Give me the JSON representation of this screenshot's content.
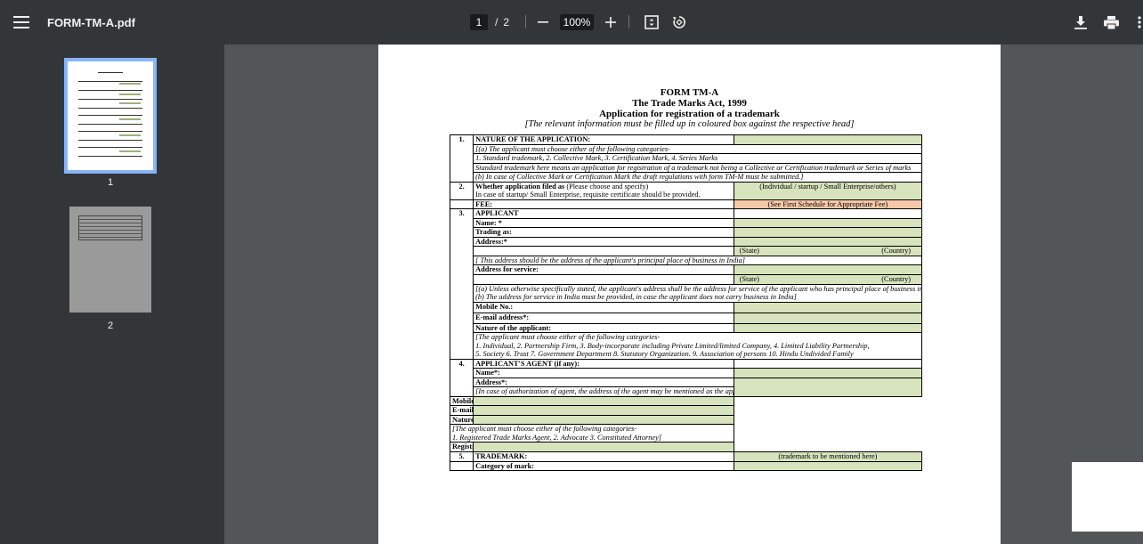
{
  "toolbar": {
    "title": "FORM-TM-A.pdf",
    "page_current": "1",
    "page_separator": "/",
    "page_total": "2",
    "zoom": "100%"
  },
  "sidebar": {
    "thumbnails": [
      {
        "label": "1"
      },
      {
        "label": "2"
      }
    ]
  },
  "document": {
    "header": {
      "line1": "FORM TM-A",
      "line2": "The Trade Marks Act, 1999",
      "line3": "Application for registration of a trademark",
      "line4": "[The relevant information must be filled up in coloured box against the respective head]"
    },
    "rows": {
      "r1_num": "1.",
      "r1_label": "NATURE OF THE APPLICATION:",
      "r1_a": "[(a) The applicant must choose either of the following categories-",
      "r1_b": "1. Standard trademark, 2. Collective Mark, 3. Certification Mark, 4. Series Marks",
      "r1_c": "Standard trademark here means an application for registration of a trademark not being a Collective or Certification trademark or Series of marks",
      "r1_d": "(b) In case of Collective Mark or Certification Mark the draft regulations with form TM-M must be submitted.]",
      "r2_num": "2.",
      "r2_label_bold": "Whether application filed as",
      "r2_label_rest": " (Please choose and specify)",
      "r2_sub": "In case of startup/ Small Enterprise, requisite certificate should be provided.",
      "r2_right": "(Individual / startup / Small Enterprise/others)",
      "fee_label": "FEE:",
      "fee_right": "(See First Schedule for Appropriate Fee)",
      "r3_num": "3.",
      "r3_label": "APPLICANT",
      "name": "Name: *",
      "trading": "Trading as:",
      "address": "Address:*",
      "state": "(State)",
      "country": "(Country)",
      "addr_note": "[ This address should be the address of the applicant's principal place of business in India]",
      "addr_service": "Address for service:",
      "service_note_a": "[(a) Unless otherwise specifically stated, the applicant's address shall be the address for service of the applicant who has principal place of business in India.",
      "service_note_b": "(b) The address for service in India must be provided, in case the applicant does not carry business in India]",
      "mobile": "Mobile No.:",
      "email": "E-mail address*:",
      "nature_applicant": "Nature of the applicant:",
      "nature_note_a": "[The applicant must choose either of the following categories-",
      "nature_note_b": "1. Individual, 2. Partnership Firm, 3. Body-incorporate including Private Limited/limited Company, 4. Limited Liability Partnership,",
      "nature_note_c": "5. Society 6. Trust 7. Government Department 8. Statutory Organization. 9. Association of persons 10. Hindu Undivided Family",
      "r4_num": "4.",
      "r4_label": "APPLICANT'S AGENT (if any):",
      "agent_name": "Name*:",
      "agent_address": "Address*:",
      "agent_note": "[In case of authorization of agent, the address of the agent may be mentioned as the applicant's address for service]",
      "agent_mobile": "Mobile No.* :",
      "agent_email": "E-mail address*:",
      "agent_nature": "Nature of the Agent:",
      "agent_nature_a": "[The applicant must choose either of the following categories-",
      "agent_nature_b": "1. Registered Trade Marks Agent, 2. Advocate 3. Constituted Attorney]",
      "reg_no": "Registration No.:",
      "r5_num": "5.",
      "r5_label": "TRADEMARK:",
      "r5_right": "(trademark to be mentioned here)",
      "category": "Category of mark:"
    }
  },
  "colors": {
    "toolbar_bg": "#323639",
    "viewer_bg": "#525659",
    "field_green": "#d6e3bc",
    "field_orange": "#f7c8a8",
    "thumb_selected": "#8ab4f8"
  },
  "icons": [
    "menu-icon",
    "zoom-out-icon",
    "zoom-in-icon",
    "fit-page-icon",
    "rotate-icon",
    "download-icon",
    "print-icon",
    "more-icon"
  ]
}
